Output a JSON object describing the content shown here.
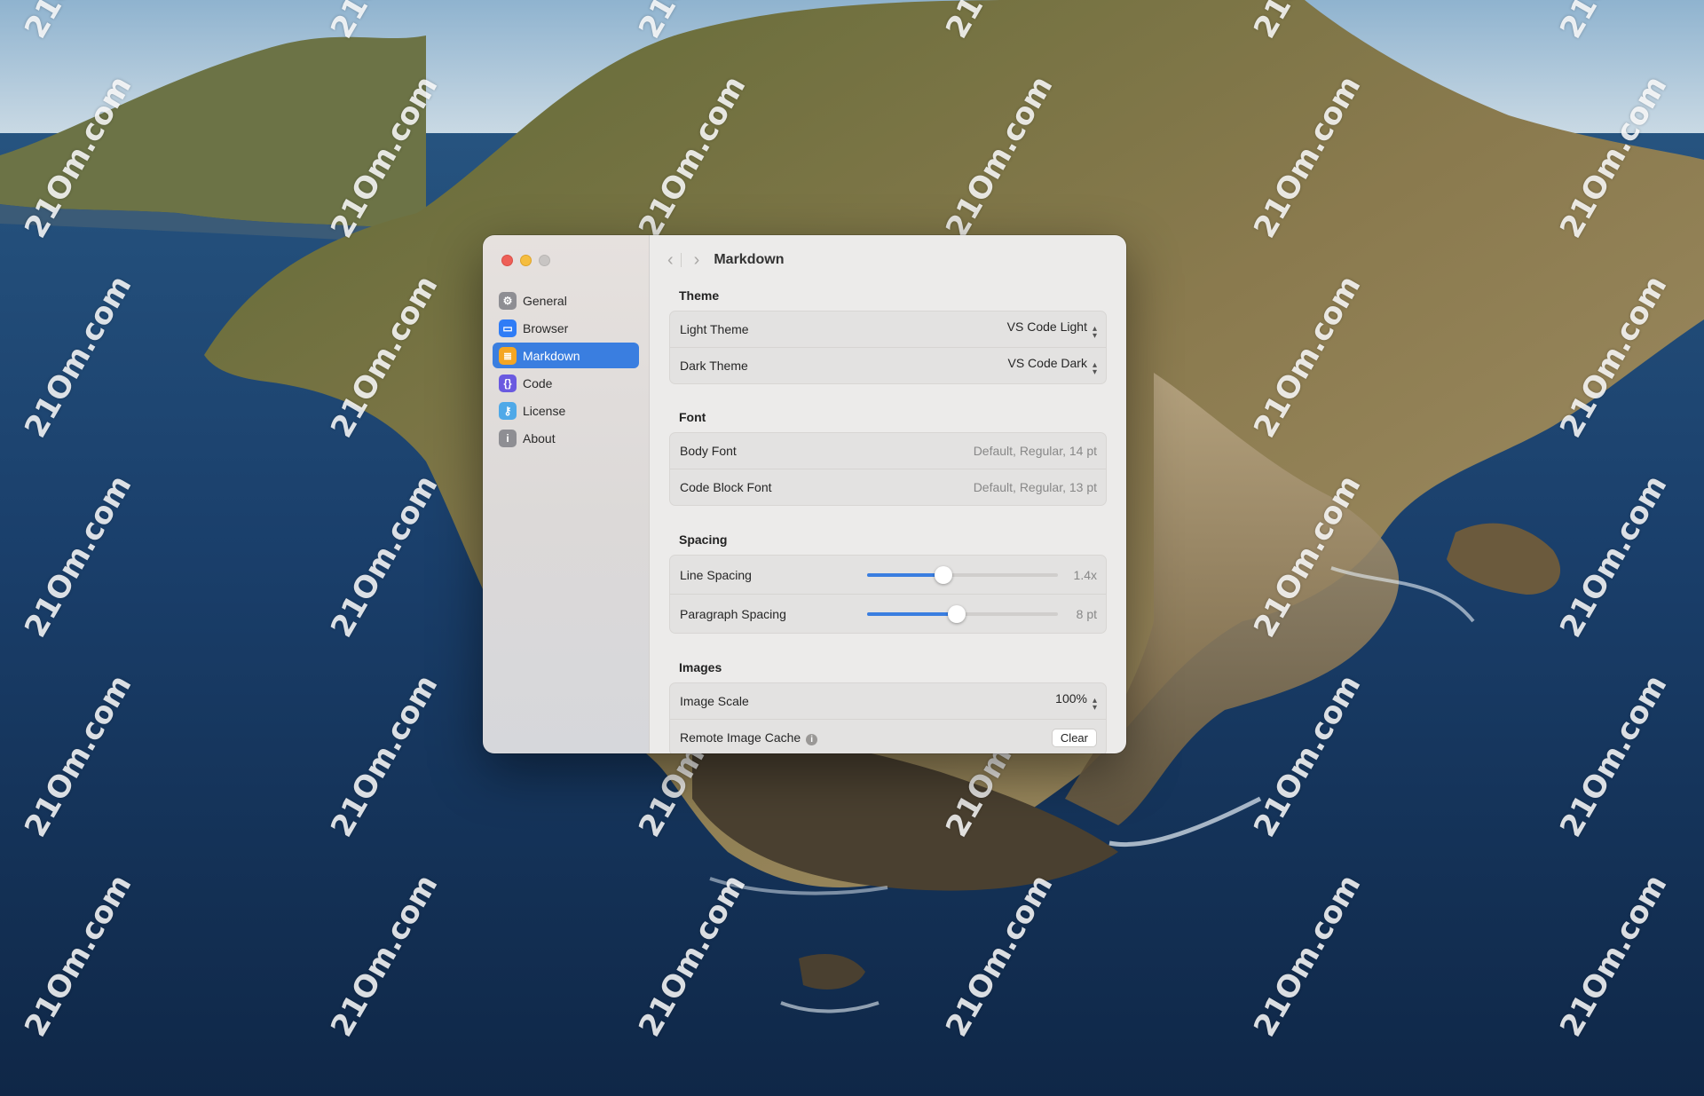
{
  "window": {
    "title": "Markdown"
  },
  "sidebar": {
    "items": [
      {
        "label": "General",
        "icon": "gear-icon",
        "color": "#8e8e93",
        "glyph": "⚙"
      },
      {
        "label": "Browser",
        "icon": "browser-window-icon",
        "color": "#2f7cf6",
        "glyph": "▭"
      },
      {
        "label": "Markdown",
        "icon": "document-icon",
        "color": "#f5a623",
        "glyph": "≣"
      },
      {
        "label": "Code",
        "icon": "curly-braces-icon",
        "color": "#6a5ae0",
        "glyph": "{}"
      },
      {
        "label": "License",
        "icon": "key-icon",
        "color": "#4fa9e8",
        "glyph": "⚷"
      },
      {
        "label": "About",
        "icon": "info-icon",
        "color": "#8e8e93",
        "glyph": "i"
      }
    ],
    "active": "Markdown"
  },
  "sections": {
    "theme": {
      "header": "Theme",
      "light_label": "Light Theme",
      "light_value": "VS Code Light",
      "dark_label": "Dark Theme",
      "dark_value": "VS Code Dark"
    },
    "font": {
      "header": "Font",
      "body_label": "Body Font",
      "body_value": "Default, Regular, 14 pt",
      "code_label": "Code Block Font",
      "code_value": "Default, Regular, 13 pt"
    },
    "spacing": {
      "header": "Spacing",
      "line_label": "Line Spacing",
      "line_value": "1.4x",
      "line_fraction": 0.4,
      "para_label": "Paragraph Spacing",
      "para_value": "8 pt",
      "para_fraction": 0.47
    },
    "images": {
      "header": "Images",
      "scale_label": "Image Scale",
      "scale_value": "100%",
      "cache_label": "Remote Image Cache",
      "clear_label": "Clear"
    }
  },
  "watermark": "21Om.com",
  "colors": {
    "accent": "#3a7ee0",
    "close": "#ee5f57",
    "minimize": "#f5bd3f"
  }
}
